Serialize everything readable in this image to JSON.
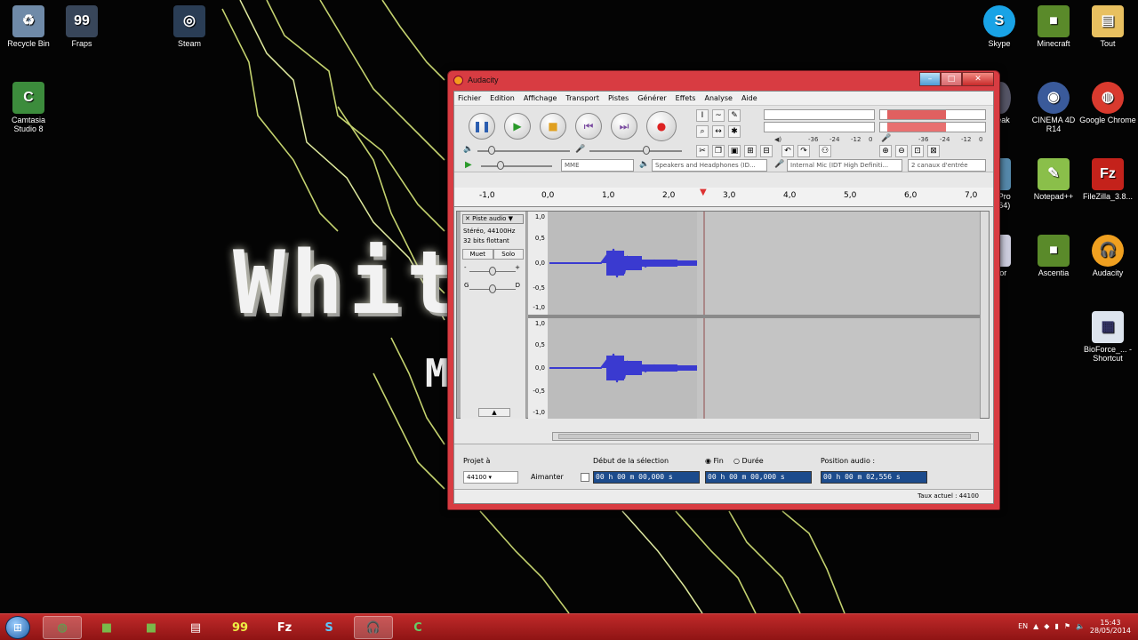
{
  "desktop": {
    "wallpaper_text": "Whit",
    "wallpaper_text2": "M",
    "left_icons": [
      {
        "label": "Recycle Bin",
        "icon": "recycle-bin-icon",
        "color": "#6f8aa8"
      },
      {
        "label": "Fraps",
        "icon": "fraps-icon",
        "color": "#38465a"
      },
      {
        "label": "Steam",
        "icon": "steam-icon",
        "color": "#2a3d55"
      },
      {
        "label": "Camtasia Studio 8",
        "icon": "camtasia-icon",
        "color": "#3c8c3c"
      }
    ],
    "right_icons": [
      {
        "label": "Skype",
        "icon": "skype-icon",
        "color": "#19a3e6"
      },
      {
        "label": "Minecraft",
        "icon": "minecraft-icon",
        "color": "#5a8a2a"
      },
      {
        "label": "Tout",
        "icon": "folder-icon",
        "color": "#e8c060"
      },
      {
        "label": "CINEMA 4D R14",
        "icon": "cinema4d-icon",
        "color": "#3a5a9a"
      },
      {
        "label": "Google Chrome",
        "icon": "chrome-icon",
        "color": "#d93a2e"
      },
      {
        "label": "Notepad++",
        "icon": "notepad-icon",
        "color": "#8abf4a"
      },
      {
        "label": "FileZilla_3.8...",
        "icon": "filezilla-icon",
        "color": "#c4221b"
      },
      {
        "label": "Ascentia",
        "icon": "minecraft-icon",
        "color": "#5a8a2a"
      },
      {
        "label": "Audacity",
        "icon": "audacity-icon",
        "color": "#f0a020"
      },
      {
        "label": "BioForce_... - Shortcut",
        "icon": "file-icon",
        "color": "#dde4ee"
      }
    ],
    "partial_labels": [
      "peak",
      "o Pro (x64)",
      "itor"
    ]
  },
  "window": {
    "title": "Audacity",
    "menu": [
      "Fichier",
      "Edition",
      "Affichage",
      "Transport",
      "Pistes",
      "Générer",
      "Effets",
      "Analyse",
      "Aide"
    ],
    "meter_scale": [
      "-36",
      "-24",
      "-12",
      "0"
    ],
    "host": "MME",
    "output_device": "Speakers and Headphones (ID...",
    "input_device": "Internal Mic (IDT High Definiti...",
    "channels": "2 canaux d'entrée",
    "ruler_ticks": [
      "-1,0",
      "0,0",
      "1,0",
      "2,0",
      "3,0",
      "4,0",
      "5,0",
      "6,0",
      "7,0"
    ],
    "track": {
      "name": "Piste audio",
      "info1": "Stéréo, 44100Hz",
      "info2": "32 bits flottant",
      "mute": "Muet",
      "solo": "Solo",
      "gain_left": "-",
      "gain_right": "+",
      "pan_left": "G",
      "pan_right": "D",
      "scale": [
        "1,0",
        "0,5",
        "0,0",
        "-0,5",
        "-1,0"
      ]
    },
    "selection": {
      "project_rate_label": "Projet à",
      "project_rate": "44100",
      "snap_label": "Aimanter",
      "start_label": "Début de la sélection",
      "end_label": "Fin",
      "length_label": "Durée",
      "position_label": "Position audio :",
      "start_value": "00 h 00 m 00,000 s",
      "end_value": "00 h 00 m 00,000 s",
      "position_value": "00 h 00 m 02,556 s"
    },
    "status": "Taux actuel : 44100"
  },
  "taskbar": {
    "apps": [
      "chrome-icon",
      "minecraft-icon",
      "minecraft-icon",
      "file-icon",
      "fraps-icon",
      "filezilla-icon",
      "skype-icon",
      "audacity-icon",
      "camtasia-icon"
    ],
    "active_apps": [
      "chrome-icon",
      "audacity-icon"
    ],
    "language": "EN",
    "time": "15:43",
    "date": "28/05/2014"
  }
}
